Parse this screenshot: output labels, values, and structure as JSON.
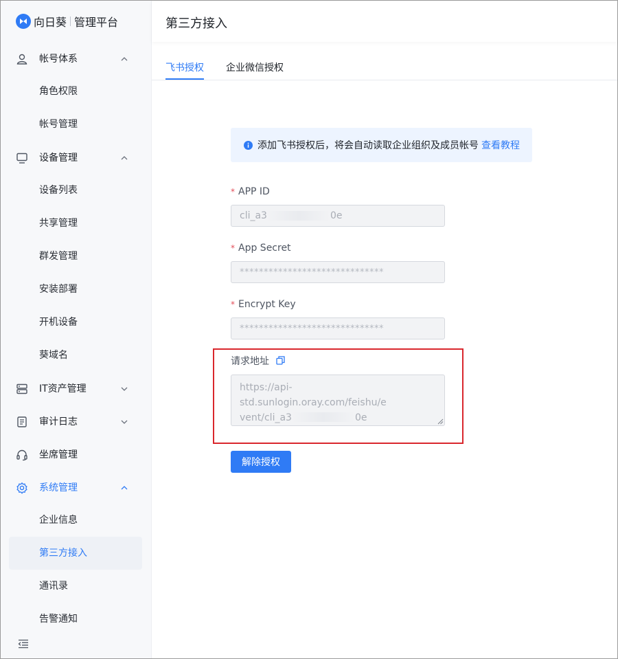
{
  "brand": {
    "name": "向日葵",
    "subtitle": "管理平台"
  },
  "sidebar": {
    "account": {
      "label": "帐号体系",
      "items": [
        "角色权限",
        "帐号管理"
      ]
    },
    "device": {
      "label": "设备管理",
      "items": [
        "设备列表",
        "共享管理",
        "群发管理",
        "安装部署",
        "开机设备",
        "葵域名"
      ]
    },
    "it_assets": {
      "label": "IT资产管理"
    },
    "audit": {
      "label": "审计日志"
    },
    "seat": {
      "label": "坐席管理"
    },
    "system": {
      "label": "系统管理",
      "items": [
        "企业信息",
        "第三方接入",
        "通讯录",
        "告警通知"
      ]
    }
  },
  "header": {
    "title": "第三方接入"
  },
  "tabs": [
    {
      "label": "飞书授权",
      "active": true
    },
    {
      "label": "企业微信授权",
      "active": false
    }
  ],
  "notice": {
    "text": "添加飞书授权后，将会自动读取企业组织及成员帐号",
    "link": "查看教程"
  },
  "form": {
    "app_id": {
      "label": "APP ID",
      "value_prefix": "cli_a3",
      "value_suffix": "0e"
    },
    "app_secret": {
      "label": "App Secret",
      "value": "******************************"
    },
    "encrypt_key": {
      "label": "Encrypt Key",
      "value": "******************************"
    },
    "request_url": {
      "label": "请求地址",
      "value_line1": "https://api-std.sunlogin.oray.com/feishu/e",
      "value_line2_prefix": "vent/cli_a3",
      "value_line2_suffix": "0e"
    }
  },
  "actions": {
    "revoke_label": "解除授权"
  },
  "colors": {
    "accent": "#2f7bf5",
    "highlight": "#d9262c",
    "required": "#e34d59"
  }
}
